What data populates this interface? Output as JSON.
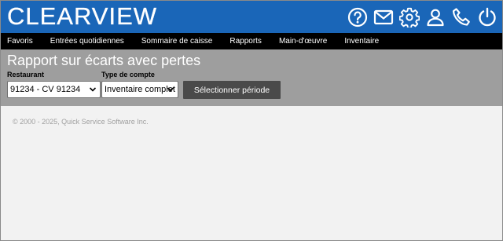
{
  "app": {
    "logo_text": "CLEARVIEW",
    "brand_color": "#1a66b8"
  },
  "top_icons": [
    "help-icon",
    "mail-icon",
    "gear-icon",
    "user-icon",
    "phone-icon",
    "power-icon"
  ],
  "nav": {
    "items": [
      {
        "label": "Favoris"
      },
      {
        "label": "Entrées quotidiennes"
      },
      {
        "label": "Sommaire de caisse"
      },
      {
        "label": "Rapports"
      },
      {
        "label": "Main-d'œuvre"
      },
      {
        "label": "Inventaire"
      }
    ]
  },
  "page": {
    "title": "Rapport sur écarts avec pertes"
  },
  "filters": {
    "restaurant_label": "Restaurant",
    "restaurant_value": "91234 - CV 91234",
    "account_type_label": "Type de compte",
    "account_type_value": "Inventaire complet",
    "select_period_label": "Sélectionner période"
  },
  "footer": {
    "copyright": "© 2000 - 2025, Quick Service Software Inc."
  }
}
